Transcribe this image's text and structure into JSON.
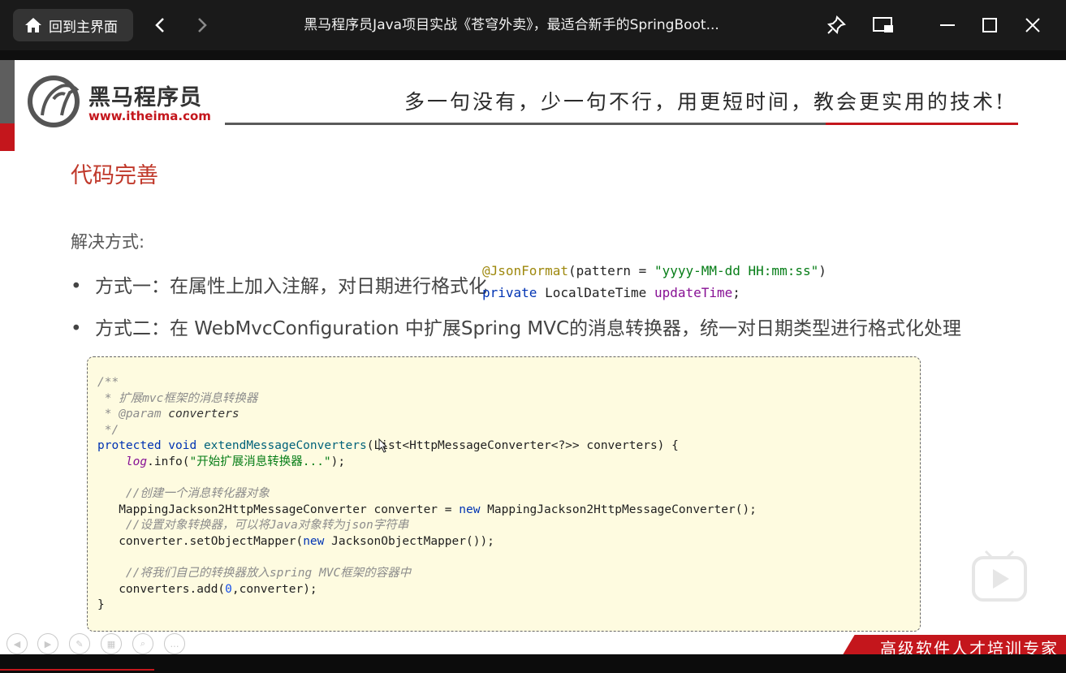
{
  "window": {
    "home_label": "回到主界面",
    "title": "黑马程序员Java项目实战《苍穹外卖》，最适合新手的SpringBoot..."
  },
  "slide": {
    "logo_name": "黑马程序员",
    "logo_url": "www.itheima.com",
    "slogan": "多一句没有，少一句不行，用更短时间，教会更实用的技术!",
    "section_title": "代码完善",
    "solution_label": "解决方式:",
    "bullets": [
      "方式一：在属性上加入注解，对日期进行格式化",
      "方式二：在 WebMvcConfiguration 中扩展Spring MVC的消息转换器，统一对日期类型进行格式化处理"
    ],
    "annotation": {
      "line1_ann": "@JsonFormat",
      "line1_pre": "(pattern = ",
      "line1_str": "\"yyyy-MM-dd HH:mm:ss\"",
      "line1_post": ")",
      "line2_kw": "private",
      "line2_type": " LocalDateTime ",
      "line2_field": "updateTime",
      "line2_end": ";"
    },
    "code": {
      "c1": "/**",
      "c2": " * 扩展mvc框架的消息转换器",
      "c3_tag": " * @param",
      "c3_rest": " converters",
      "c4": " */",
      "sig_kw": "protected void ",
      "sig_fn": "extendMessageConverters",
      "sig_rest": "(List<HttpMessageConverter<?>> converters) {",
      "log_fld": "log",
      "log_mid": ".info(",
      "log_str": "\"开始扩展消息转换器...\"",
      "log_end": ");",
      "cm1": "//创建一个消息转化器对象",
      "l_new1_pre": "MappingJackson2HttpMessageConverter converter = ",
      "l_new1_kw": "new",
      "l_new1_post": " MappingJackson2HttpMessageConverter();",
      "cm2": "//设置对象转换器，可以将Java对象转为json字符串",
      "l_set_pre": "converter.setObjectMapper(",
      "l_set_kw": "new",
      "l_set_post": " JacksonObjectMapper());",
      "cm3": "//将我们自己的转换器放入spring MVC框架的容器中",
      "l_add_pre": "converters.add(",
      "l_add_num": "0",
      "l_add_post": ",converter);",
      "close": "}"
    }
  },
  "player": {
    "tagline": "高级软件人才培训专家"
  }
}
